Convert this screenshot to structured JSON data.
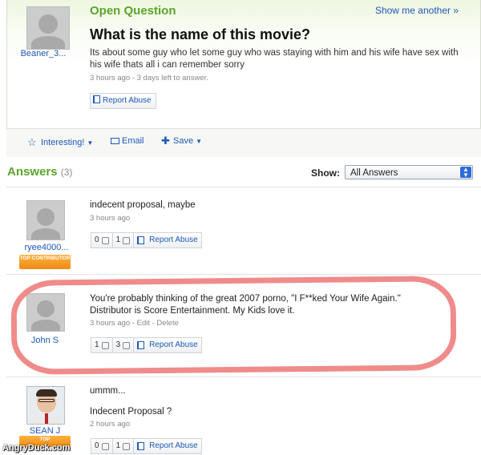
{
  "question": {
    "label": "Open Question",
    "show_another": "Show me another »",
    "title": "What is the name of this movie?",
    "detail": "Its about some guy who let some guy who was staying with him and his wife have sex with his wife thats all i can remember sorry",
    "meta": "3 hours ago - 3 days left to answer.",
    "author": "Beaner_3...",
    "report": "Report Abuse",
    "actions": {
      "interesting": "Interesting!",
      "email": "Email",
      "save": "Save"
    }
  },
  "answers_header": {
    "title": "Answers",
    "count": "(3)",
    "show_label": "Show:",
    "filter_value": "All Answers"
  },
  "answers": [
    {
      "author": "ryee4000...",
      "badge": "TOP CONTRIBUTOR",
      "text": "indecent proposal, maybe",
      "meta": "3 hours ago",
      "up": "0",
      "down": "1",
      "report": "Report Abuse"
    },
    {
      "author": "John S",
      "text": "You're probably thinking of the great 2007 porno, \"I F**ked Your Wife Again.\" Distributor is Score Entertainment. My Kids love it.",
      "meta": "3 hours ago - Edit - Delete",
      "up": "1",
      "down": "3",
      "report": "Report Abuse"
    },
    {
      "author": "SEAN J",
      "badge": "TOP",
      "text1": "ummm...",
      "text2": "Indecent Proposal ?",
      "meta": "2 hours ago",
      "up": "0",
      "down": "1",
      "report": "Report Abuse"
    }
  ],
  "watermark": "AngryDuck.com",
  "colors": {
    "accent_green": "#5ba52c",
    "link_blue": "#1d58b8",
    "highlight": "#f08b8b",
    "badge_orange": "#f08b16"
  }
}
